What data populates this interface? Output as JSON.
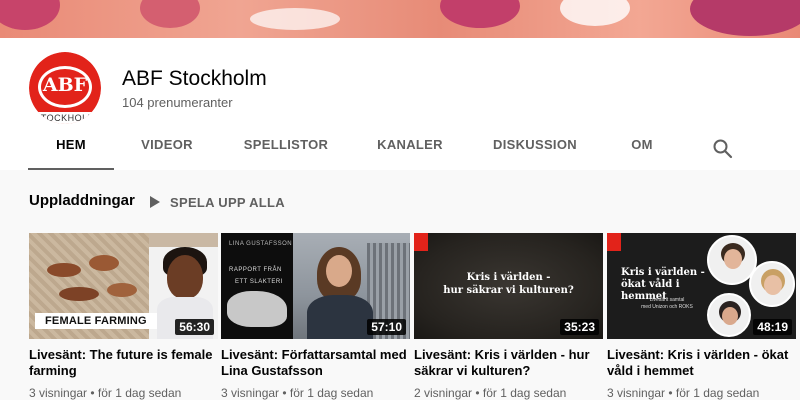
{
  "channel": {
    "name": "ABF Stockholm",
    "subscribers": "104 prenumeranter",
    "logo_text": "ABF",
    "logo_city": "STOCKHOLM"
  },
  "tabs": [
    {
      "label": "HEM",
      "active": true
    },
    {
      "label": "VIDEOR",
      "active": false
    },
    {
      "label": "SPELLISTOR",
      "active": false
    },
    {
      "label": "KANALER",
      "active": false
    },
    {
      "label": "DISKUSSION",
      "active": false
    },
    {
      "label": "OM",
      "active": false
    }
  ],
  "search_icon": "search-icon",
  "section": {
    "title": "Uppladdningar",
    "play_all": "SPELA UPP ALLA",
    "play_icon": "play-icon"
  },
  "videos": [
    {
      "title": "Livesänt: The future is female farming",
      "meta": "3 visningar • för 1 dag sedan",
      "duration": "56:30",
      "thumb_text": "FEMALE FARMING"
    },
    {
      "title": "Livesänt: Författarsamtal med Lina Gustafsson",
      "meta": "3 visningar • för 1 dag sedan",
      "duration": "57:10",
      "thumb_author": "LINA GUSTAFSSON",
      "thumb_book_line1": "RAPPORT FRÅN",
      "thumb_book_line2": "ETT SLAKTERI"
    },
    {
      "title": "Livesänt: Kris i världen - hur säkrar vi kulturen?",
      "meta": "2 visningar • för 1 dag sedan",
      "duration": "35:23",
      "thumb_line1": "Kris i världen -",
      "thumb_line2": "hur säkrar vi kulturen?"
    },
    {
      "title": "Livesänt: Kris i världen - ökat våld i hemmet",
      "meta": "3 visningar • för 1 dag sedan",
      "duration": "48:19",
      "thumb_line1": "Kris i världen -",
      "thumb_line2": "ökat våld i hemmet",
      "thumb_small1": "Livesänt samtal",
      "thumb_small2": "med Unizon och ROKS"
    }
  ],
  "colors": {
    "brand_red": "#e2231a",
    "text_secondary": "#606060",
    "background": "#f9f9f9"
  }
}
